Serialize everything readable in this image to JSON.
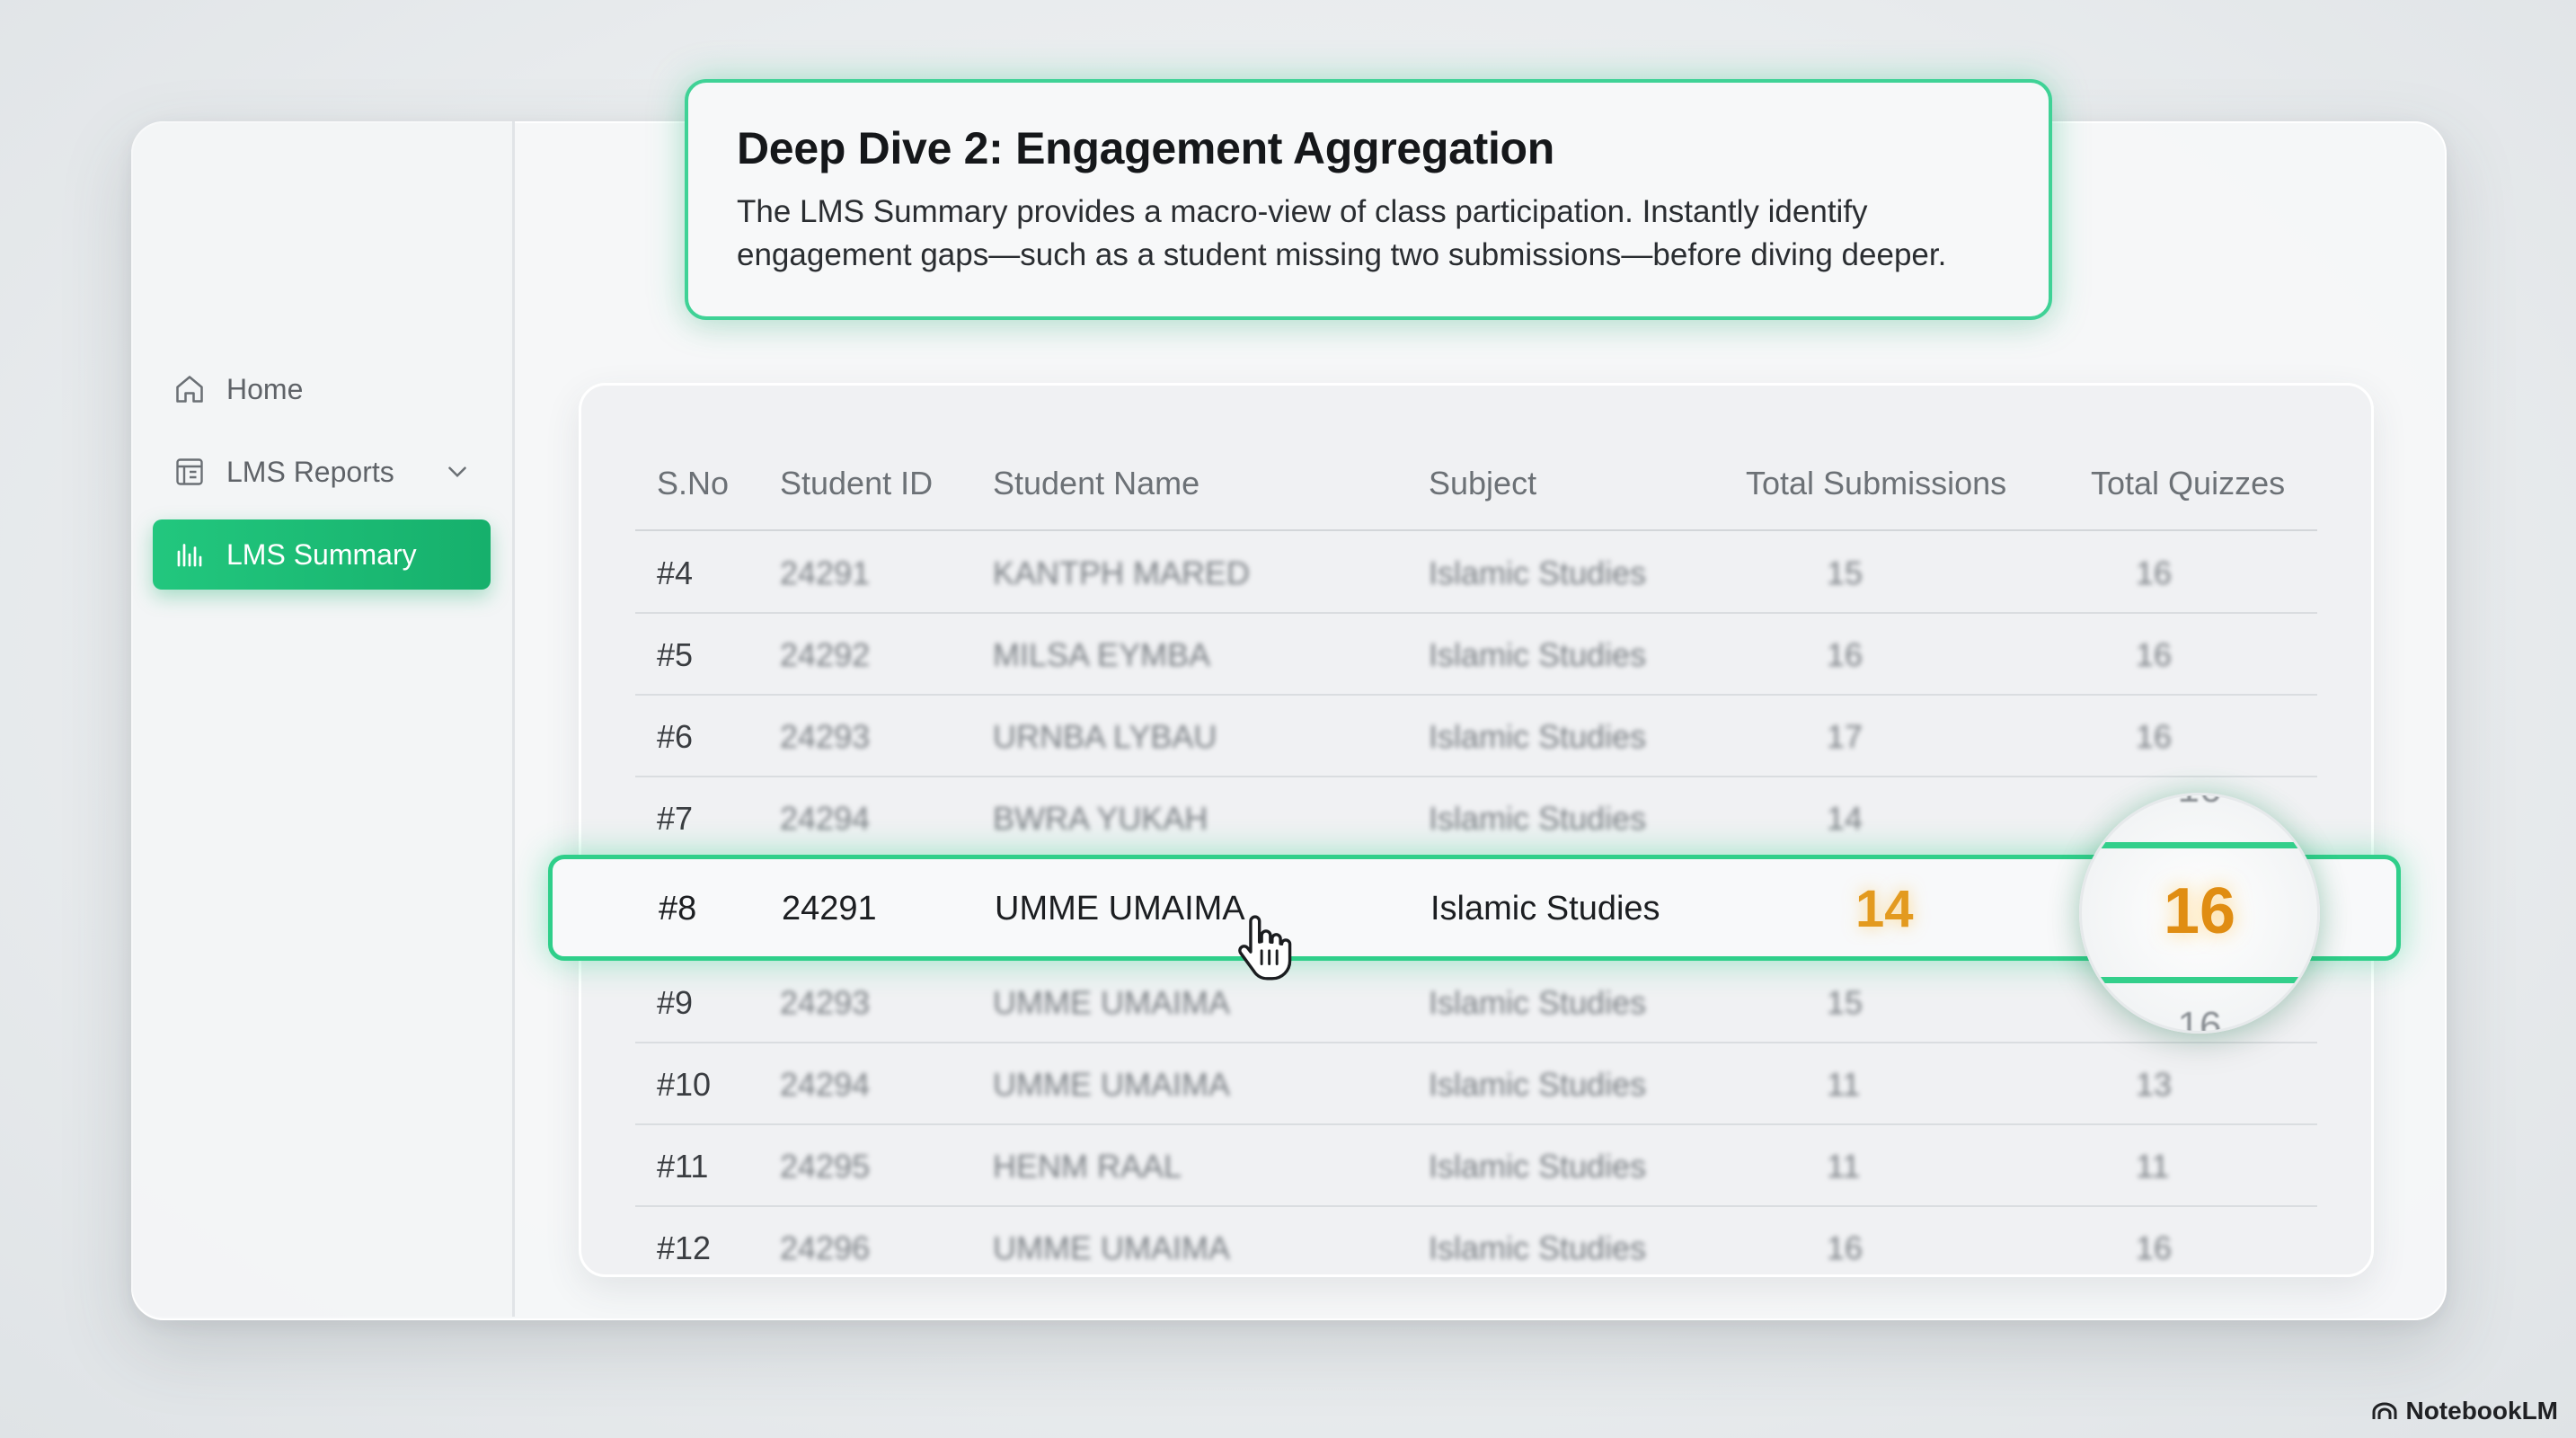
{
  "sidebar": {
    "items": [
      {
        "label": "Home",
        "icon": "home-icon"
      },
      {
        "label": "LMS Reports",
        "icon": "report-icon"
      },
      {
        "label": "LMS Summary",
        "icon": "bar-chart-icon",
        "active": true
      }
    ]
  },
  "callout": {
    "title": "Deep Dive 2: Engagement Aggregation",
    "line1": "The LMS Summary provides a macro-view of class participation. Instantly identify",
    "line2": "engagement gaps—such as a student missing two submissions—before diving deeper."
  },
  "table": {
    "headers": [
      "S.No",
      "Student ID",
      "Student Name",
      "Subject",
      "Total Submissions",
      "Total Quizzes"
    ],
    "rows": [
      {
        "sno": "#4",
        "id": "24291",
        "name": "KANTPH MARED",
        "subject": "Islamic Studies",
        "submissions": "15",
        "quizzes": "16"
      },
      {
        "sno": "#5",
        "id": "24292",
        "name": "MILSA EYMBA",
        "subject": "Islamic Studies",
        "submissions": "16",
        "quizzes": "16"
      },
      {
        "sno": "#6",
        "id": "24293",
        "name": "URNBA LYBAU",
        "subject": "Islamic Studies",
        "submissions": "17",
        "quizzes": "16"
      },
      {
        "sno": "#7",
        "id": "24294",
        "name": "BWRA YUKAH",
        "subject": "Islamic Studies",
        "submissions": "14",
        "quizzes": ""
      },
      {
        "sno": "#9",
        "id": "24293",
        "name": "UMME UMAIMA",
        "subject": "Islamic Studies",
        "submissions": "15",
        "quizzes": ""
      },
      {
        "sno": "#10",
        "id": "24294",
        "name": "UMME UMAIMA",
        "subject": "Islamic Studies",
        "submissions": "11",
        "quizzes": "13"
      },
      {
        "sno": "#11",
        "id": "24295",
        "name": "HENM RAAL",
        "subject": "Islamic Studies",
        "submissions": "11",
        "quizzes": "11"
      },
      {
        "sno": "#12",
        "id": "24296",
        "name": "UMME UMAIMA",
        "subject": "Islamic Studies",
        "submissions": "16",
        "quizzes": "16"
      }
    ],
    "highlighted": {
      "sno": "#8",
      "id": "24291",
      "name": "UMME UMAIMA",
      "subject": "Islamic Studies",
      "submissions": "14",
      "quizzes": "16"
    }
  },
  "colors": {
    "accent": "#1fbf78",
    "highlight_number": "#e39a1f"
  },
  "brand": "NotebookLM"
}
